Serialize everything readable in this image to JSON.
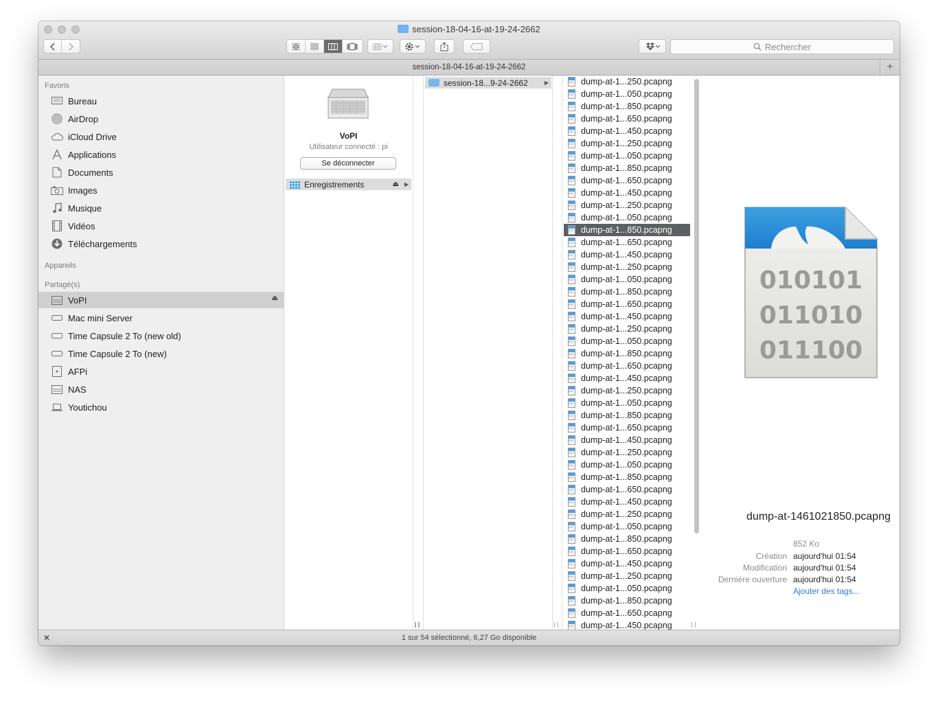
{
  "window": {
    "title": "session-18-04-16-at-19-24-2662"
  },
  "toolbar": {
    "search_placeholder": "Rechercher"
  },
  "pathbar": {
    "label": "session-18-04-16-at-19-24-2662",
    "plus": "+"
  },
  "sidebar": {
    "favorites_header": "Favoris",
    "favorites": [
      {
        "label": "Bureau",
        "icon": "desktop-icon"
      },
      {
        "label": "AirDrop",
        "icon": "airdrop-icon"
      },
      {
        "label": "iCloud Drive",
        "icon": "cloud-icon"
      },
      {
        "label": "Applications",
        "icon": "applications-icon"
      },
      {
        "label": "Documents",
        "icon": "documents-icon"
      },
      {
        "label": "Images",
        "icon": "camera-icon"
      },
      {
        "label": "Musique",
        "icon": "music-note-icon"
      },
      {
        "label": "Vidéos",
        "icon": "film-icon"
      },
      {
        "label": "Téléchargements",
        "icon": "download-icon"
      }
    ],
    "devices_header": "Appareils",
    "shared_header": "Partagé(s)",
    "shared": [
      {
        "label": "VoPI",
        "icon": "server-icon",
        "selected": true
      },
      {
        "label": "Mac mini Server",
        "icon": "mac-mini-icon"
      },
      {
        "label": "Time Capsule 2 To (new old)",
        "icon": "time-capsule-icon"
      },
      {
        "label": "Time Capsule 2 To (new)",
        "icon": "time-capsule-icon"
      },
      {
        "label": "AFPi",
        "icon": "generic-server-icon"
      },
      {
        "label": "NAS",
        "icon": "server-icon"
      },
      {
        "label": "Youtichou",
        "icon": "laptop-icon"
      }
    ]
  },
  "server_column": {
    "name": "VoPI",
    "user": "Utilisateur connecté : pi",
    "disconnect_label": "Se déconnecter",
    "share": "Enregistrements"
  },
  "folder_column": {
    "item": "session-18...9-24-2662"
  },
  "files": [
    "dump-at-1...250.pcapng",
    "dump-at-1...050.pcapng",
    "dump-at-1...850.pcapng",
    "dump-at-1...650.pcapng",
    "dump-at-1...450.pcapng",
    "dump-at-1...250.pcapng",
    "dump-at-1...050.pcapng",
    "dump-at-1...850.pcapng",
    "dump-at-1...650.pcapng",
    "dump-at-1...450.pcapng",
    "dump-at-1...250.pcapng",
    "dump-at-1...050.pcapng",
    "dump-at-1...850.pcapng",
    "dump-at-1...650.pcapng",
    "dump-at-1...450.pcapng",
    "dump-at-1...250.pcapng",
    "dump-at-1...050.pcapng",
    "dump-at-1...850.pcapng",
    "dump-at-1...650.pcapng",
    "dump-at-1...450.pcapng",
    "dump-at-1...250.pcapng",
    "dump-at-1...050.pcapng",
    "dump-at-1...850.pcapng",
    "dump-at-1...650.pcapng",
    "dump-at-1...450.pcapng",
    "dump-at-1...250.pcapng",
    "dump-at-1...050.pcapng",
    "dump-at-1...850.pcapng",
    "dump-at-1...650.pcapng",
    "dump-at-1...450.pcapng",
    "dump-at-1...250.pcapng",
    "dump-at-1...050.pcapng",
    "dump-at-1...850.pcapng",
    "dump-at-1...650.pcapng",
    "dump-at-1...450.pcapng",
    "dump-at-1...250.pcapng",
    "dump-at-1...050.pcapng",
    "dump-at-1...850.pcapng",
    "dump-at-1...650.pcapng",
    "dump-at-1...450.pcapng",
    "dump-at-1...250.pcapng",
    "dump-at-1...050.pcapng",
    "dump-at-1...850.pcapng",
    "dump-at-1...650.pcapng",
    "dump-at-1...450.pcapng"
  ],
  "selected_file_index": 12,
  "preview": {
    "binary_lines": [
      "010101",
      "011010",
      "011100"
    ],
    "filename": "dump-at-1461021850.pcapng",
    "size": "852 Ko",
    "creation_label": "Création",
    "creation_value": "aujourd'hui 01:54",
    "modification_label": "Modification",
    "modification_value": "aujourd'hui 01:54",
    "last_opened_label": "Dernière ouverture",
    "last_opened_value": "aujourd'hui 01:54",
    "add_tags": "Ajouter des tags..."
  },
  "status": {
    "text": "1 sur 54 sélectionné, 6,27 Go disponible"
  }
}
